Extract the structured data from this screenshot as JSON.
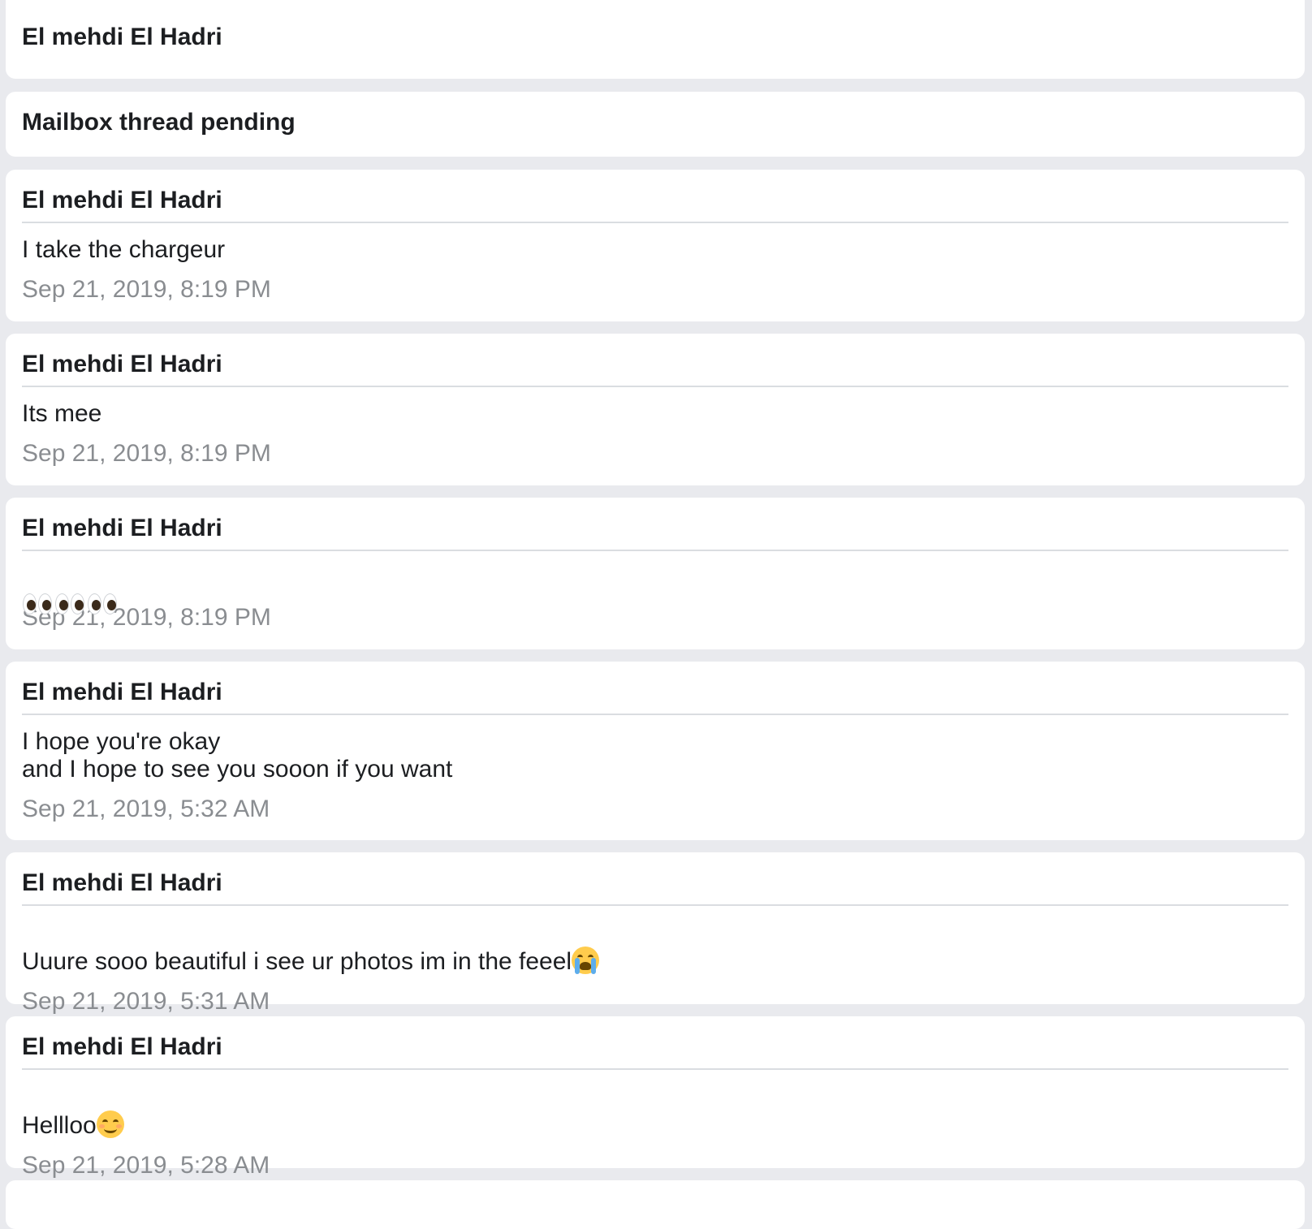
{
  "header_card": {
    "name": "El mehdi El Hadri"
  },
  "status_card": {
    "label": "Mailbox thread pending"
  },
  "messages": [
    {
      "sender": "El mehdi El Hadri",
      "text": "I take the chargeur",
      "timestamp": "Sep 21, 2019, 8:19 PM"
    },
    {
      "sender": "El mehdi El Hadri",
      "text": "Its mee",
      "timestamp": "Sep 21, 2019, 8:19 PM"
    },
    {
      "sender": "El mehdi El Hadri",
      "text": "👀👀👀",
      "timestamp": "Sep 21, 2019, 8:19 PM"
    },
    {
      "sender": "El mehdi El Hadri",
      "text": "I hope you're okay\nand I hope to see you sooon if you want",
      "timestamp": "Sep 21, 2019, 5:32 AM"
    },
    {
      "sender": "El mehdi El Hadri",
      "text": "Uuure sooo beautiful i see ur photos im in the feeel",
      "text_emoji": "loudly-crying-face-icon",
      "timestamp": "Sep 21, 2019, 5:31 AM"
    },
    {
      "sender": "El mehdi El Hadri",
      "text": "Hellloo",
      "text_emoji": "smiling-face-icon",
      "timestamp": "Sep 21, 2019, 5:28 AM"
    }
  ],
  "colors": {
    "background": "#e9eaee",
    "card": "#ffffff",
    "text": "#1c1e21",
    "timestamp": "#8a8d91",
    "divider": "#dadde1"
  }
}
